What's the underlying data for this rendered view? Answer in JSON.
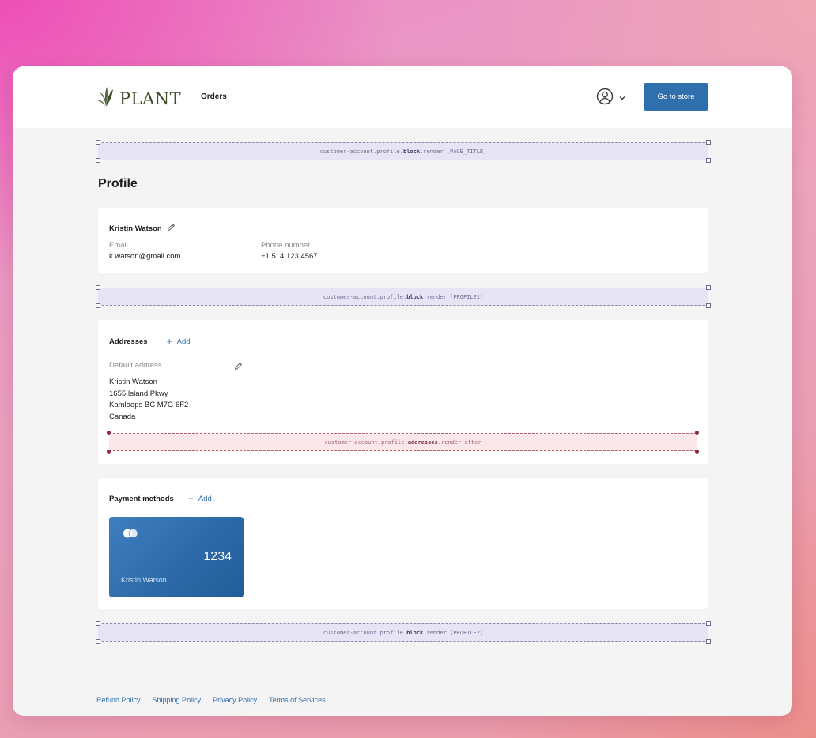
{
  "brand": {
    "name": "PLANT"
  },
  "nav": {
    "orders": "Orders",
    "go_to_store": "Go to store"
  },
  "extensions": {
    "page_title": {
      "prefix": "customer-account.profile.",
      "bold": "block",
      "suffix": ".render [PAGE_TITLE]"
    },
    "profile1": {
      "prefix": "customer-account.profile.",
      "bold": "block",
      "suffix": ".render [PROFILE1]"
    },
    "addresses_after": {
      "prefix": "customer-account.profile.",
      "bold": "addresses",
      "suffix": ".render-after"
    },
    "profile2": {
      "prefix": "customer-account.profile.",
      "bold": "block",
      "suffix": ".render [PROFILE2]"
    }
  },
  "page": {
    "title": "Profile"
  },
  "profile": {
    "name": "Kristin Watson",
    "email_label": "Email",
    "email": "k.watson@gmail.com",
    "phone_label": "Phone number",
    "phone": "+1 514 123 4567"
  },
  "addresses": {
    "title": "Addresses",
    "add_label": "Add",
    "default_label": "Default address",
    "lines": [
      "Kristin Watson",
      "1655 Island Pkwy",
      "Kamloops BC M7G 6F2",
      "Canada"
    ]
  },
  "payments": {
    "title": "Payment methods",
    "add_label": "Add",
    "card": {
      "last4": "1234",
      "holder": "Kristin Watson"
    }
  },
  "footer": {
    "links": [
      "Refund Policy",
      "Shipping Policy",
      "Privacy Policy",
      "Terms of Services"
    ]
  },
  "colors": {
    "accent": "#2f6fad",
    "extension_block": "#e1def5",
    "extension_render_after": "#fae2e6"
  },
  "icons": [
    "plant-leaf-logo-icon",
    "user-circle-icon",
    "chevron-down-icon",
    "pencil-icon",
    "plus-icon",
    "card-network-icon"
  ]
}
